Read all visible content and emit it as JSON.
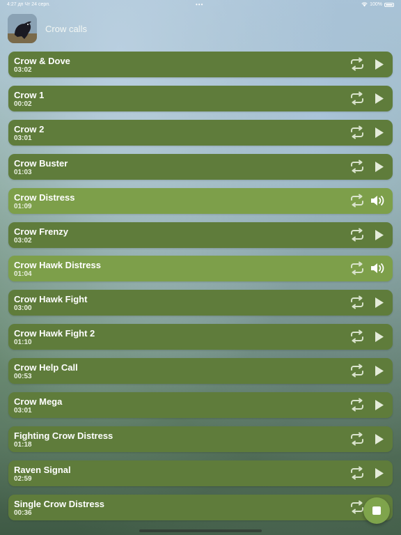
{
  "status": {
    "time": "4:27 дп",
    "date": "Чт 24 серп.",
    "dots": "•••",
    "battery": "100%"
  },
  "header": {
    "title": "Crow calls",
    "app_icon": "crow-photo"
  },
  "tracks": [
    {
      "title": "Crow & Dove",
      "duration": "03:02",
      "state": "idle"
    },
    {
      "title": "Crow 1",
      "duration": "00:02",
      "state": "idle"
    },
    {
      "title": "Crow 2",
      "duration": "03:01",
      "state": "idle"
    },
    {
      "title": "Crow Buster",
      "duration": "01:03",
      "state": "idle"
    },
    {
      "title": "Crow Distress",
      "duration": "01:09",
      "state": "playing"
    },
    {
      "title": "Crow Frenzy",
      "duration": "03:02",
      "state": "idle"
    },
    {
      "title": "Crow Hawk Distress",
      "duration": "01:04",
      "state": "playing"
    },
    {
      "title": "Crow Hawk Fight",
      "duration": "03:00",
      "state": "idle"
    },
    {
      "title": "Crow Hawk Fight 2",
      "duration": "01:10",
      "state": "idle"
    },
    {
      "title": "Crow Help Call",
      "duration": "00:53",
      "state": "idle"
    },
    {
      "title": "Crow Mega",
      "duration": "03:01",
      "state": "idle"
    },
    {
      "title": "Fighting Crow Distress",
      "duration": "01:18",
      "state": "idle"
    },
    {
      "title": "Raven Signal",
      "duration": "02:59",
      "state": "idle"
    },
    {
      "title": "Single Crow Distress",
      "duration": "00:36",
      "state": "idle"
    }
  ],
  "icons": {
    "repeat": "repeat-icon",
    "play": "play-icon",
    "speaker": "speaker-icon",
    "stop": "stop-icon"
  },
  "colors": {
    "row": "#5f7c3b",
    "row_active": "#7d9f4a",
    "stop_button": "#7fa44c"
  }
}
